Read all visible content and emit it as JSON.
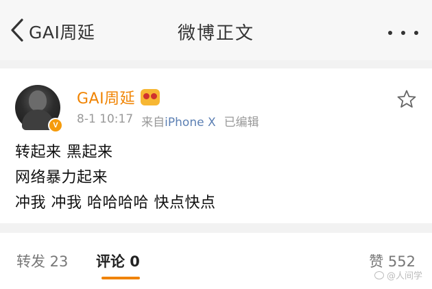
{
  "navbar": {
    "back_label": "GAI周延",
    "title": "微博正文"
  },
  "post": {
    "author": "GAI周延",
    "verified_badge": "V",
    "timestamp": "8-1 10:17",
    "source_prefix": "来自",
    "source_device": "iPhone X",
    "edited_label": "已编辑",
    "lines": [
      "转起来 黑起来",
      "网络暴力起来",
      "冲我 冲我 哈哈哈哈 快点快点"
    ]
  },
  "tabs": {
    "repost": "转发 23",
    "comments": "评论 0",
    "likes": "赞 552"
  },
  "watermark": "@人间学",
  "colors": {
    "accent_orange": "#f08300",
    "link_blue": "#5b7fb3",
    "badge": "#f59b0c"
  },
  "icons": {
    "back": "chevron-left-icon",
    "more": "more-dots-icon",
    "favorite": "star-outline-icon",
    "vip": "vip-crown-icon"
  }
}
